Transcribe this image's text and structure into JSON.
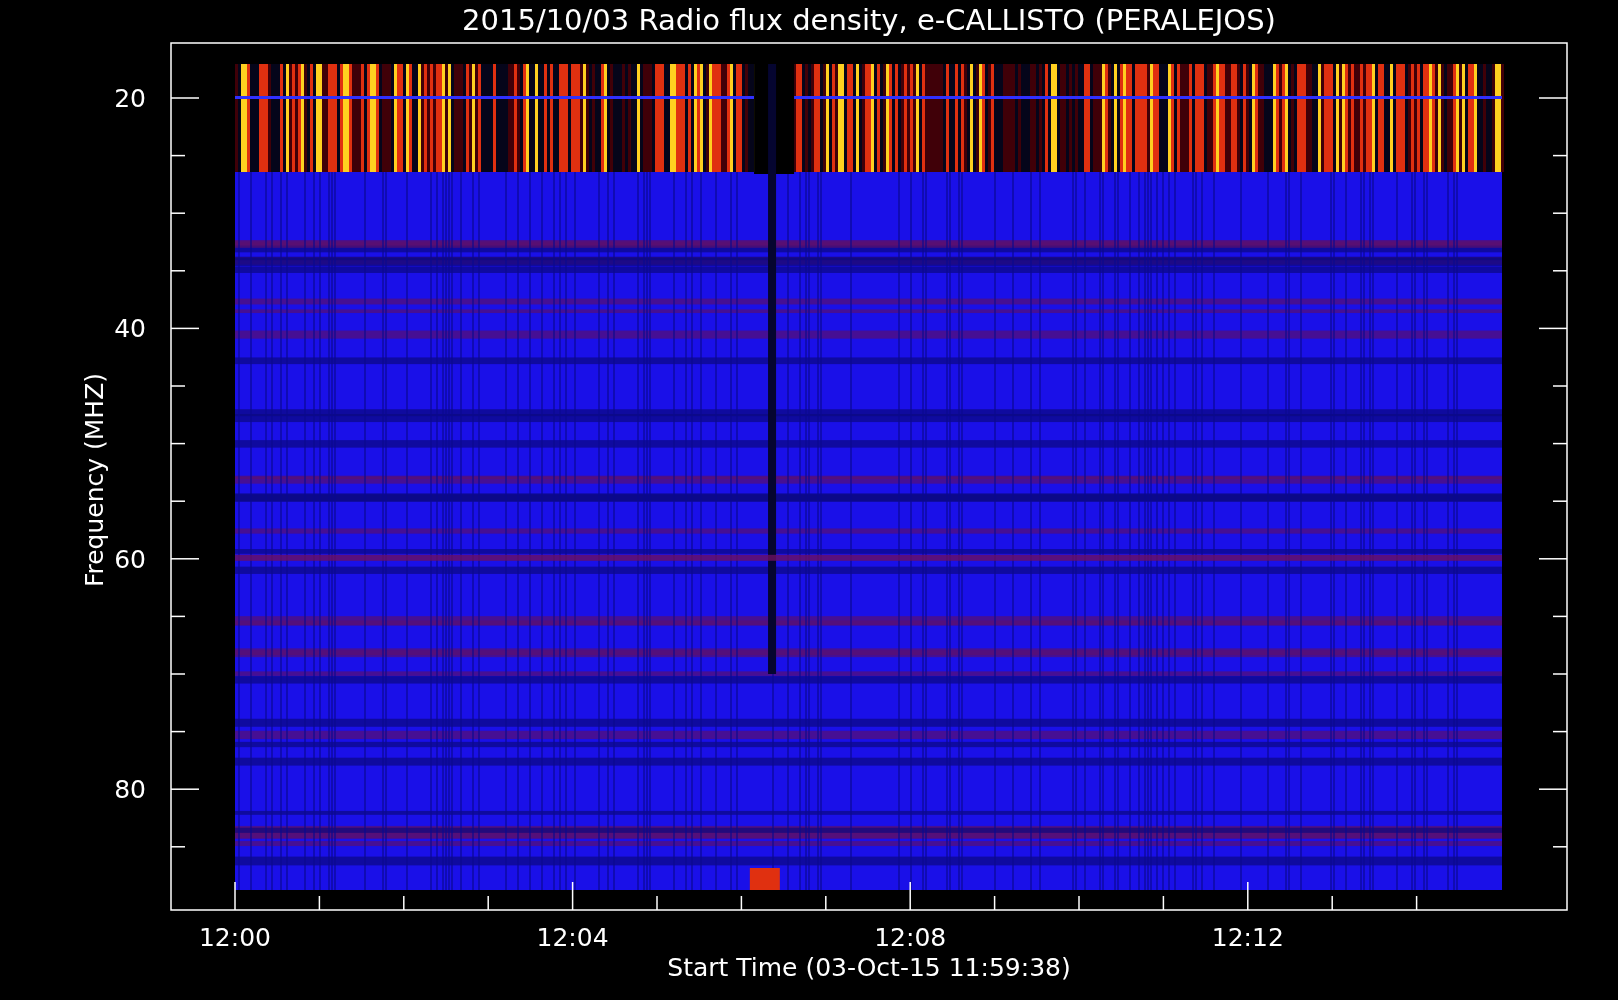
{
  "plot": {
    "title": "2015/10/03  Radio flux density, e-CALLISTO (PERALEJOS)",
    "xlabel": "Start Time (03-Oct-15 11:59:38)",
    "ylabel": "Frequency (MHZ)",
    "x_tick_labels": [
      "12:00",
      "12:04",
      "12:08",
      "12:12"
    ],
    "y_tick_labels": [
      "20",
      "40",
      "60",
      "80"
    ]
  }
}
